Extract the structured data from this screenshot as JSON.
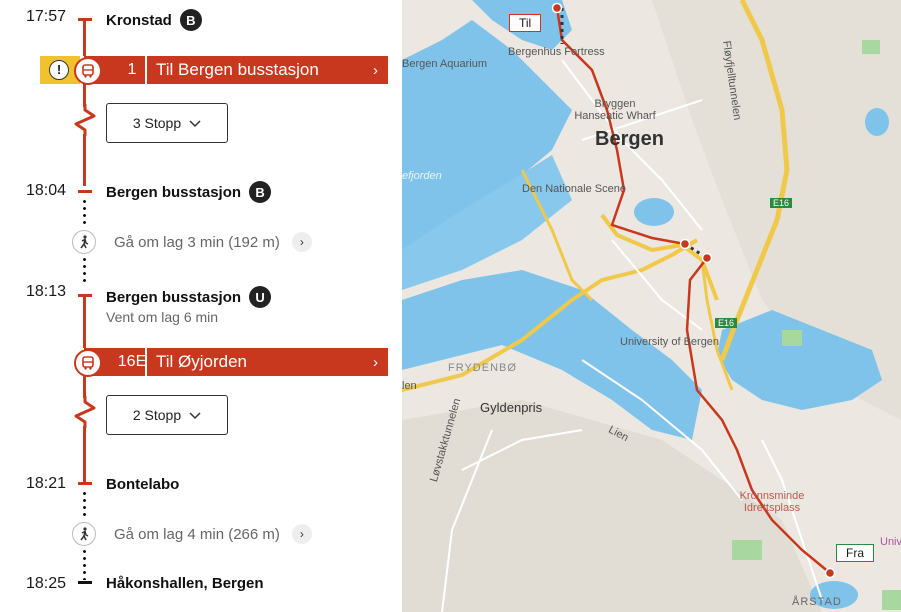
{
  "itinerary": {
    "stop1": {
      "time": "17:57",
      "name": "Kronstad",
      "platform": "B"
    },
    "leg1": {
      "route": "1",
      "destination": "Til Bergen busstasjon",
      "stops_label": "3 Stopp",
      "warning_symbol": "!"
    },
    "stop2": {
      "time": "18:04",
      "name": "Bergen busstasjon",
      "platform": "B"
    },
    "walk1": {
      "text": "Gå om lag 3 min (192 m)"
    },
    "stop3": {
      "time": "18:13",
      "name": "Bergen busstasjon",
      "platform": "U",
      "wait": "Vent om lag 6 min"
    },
    "leg2": {
      "route": "16E",
      "destination": "Til Øyjorden",
      "stops_label": "2 Stopp"
    },
    "stop4": {
      "time": "18:21",
      "name": "Bontelabo"
    },
    "walk2": {
      "text": "Gå om lag 4 min (266 m)"
    },
    "stop5": {
      "time": "18:25",
      "name": "Håkonshallen, Bergen"
    }
  },
  "map": {
    "labels": {
      "bergen": "Bergen",
      "aquarium": "Bergen Aquarium",
      "fortress": "Bergenhus Fortress",
      "bryggen": "Bryggen Hanseatic Wharf",
      "scene": "Den Nationale Scene",
      "university": "University of Bergen",
      "frydenbo": "FRYDENBØ",
      "gyldenpris": "Gyldenpris",
      "lien": "Lien",
      "lovstakk": "Løvstakktunnelen",
      "floyfjell": "Fløyfjelltunnelen",
      "kronnsminde": "Kronnsminde Idrettsplass",
      "arstad": "ÅRSTAD",
      "e16a": "E16",
      "e16b": "E16",
      "fjorden": "efjorden",
      "univ_edge": "Univ",
      "len_edge": "len"
    },
    "callout_to": "Til",
    "callout_from": "Fra",
    "route_color": "#c8381e"
  }
}
